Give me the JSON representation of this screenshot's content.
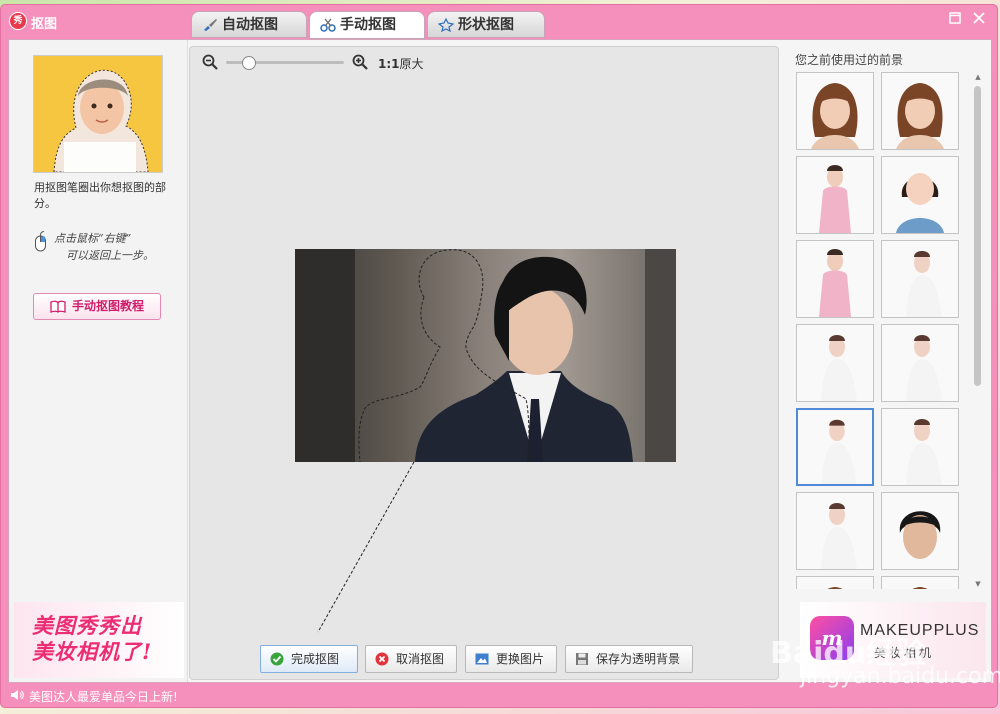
{
  "window": {
    "title": "抠图",
    "app_icon_text": "秀",
    "minimize_icon": "maximize-icon",
    "close_icon": "close-icon"
  },
  "tabs": [
    {
      "label": "自动抠图",
      "icon": "brush-icon"
    },
    {
      "label": "手动抠图",
      "icon": "scissors-icon",
      "active": true
    },
    {
      "label": "形状抠图",
      "icon": "shape-icon"
    }
  ],
  "left_panel": {
    "help_text": "用抠图笔圈出你想抠图的部分。",
    "hint_line1": "点击鼠标“右键”",
    "hint_line2": "可以返回上一步。",
    "tutorial_button": "手动抠图教程",
    "ad_line1": "美图秀秀出",
    "ad_line2": "美妆相机了!"
  },
  "toolbar": {
    "zoom_level": 0.15,
    "ratio_bold": "1:1",
    "ratio_text": "原大"
  },
  "actions": {
    "done": "完成抠图",
    "cancel": "取消抠图",
    "replace": "更换图片",
    "save_transparent": "保存为透明背景"
  },
  "right_panel": {
    "title": "您之前使用过的前景",
    "ad_brand": "MAKEUPPLUS",
    "ad_sub": "美妆相机",
    "ad_logo": "m"
  },
  "status": {
    "text": "美图达人最爱单品今日上新!"
  },
  "watermark": {
    "main": "Baidu经验",
    "sub": "jingyan.baidu.com"
  },
  "colors": {
    "window_pink": "#f58fbb",
    "accent_pink": "#ec2d74",
    "selected_blue": "#4f8bd8"
  }
}
